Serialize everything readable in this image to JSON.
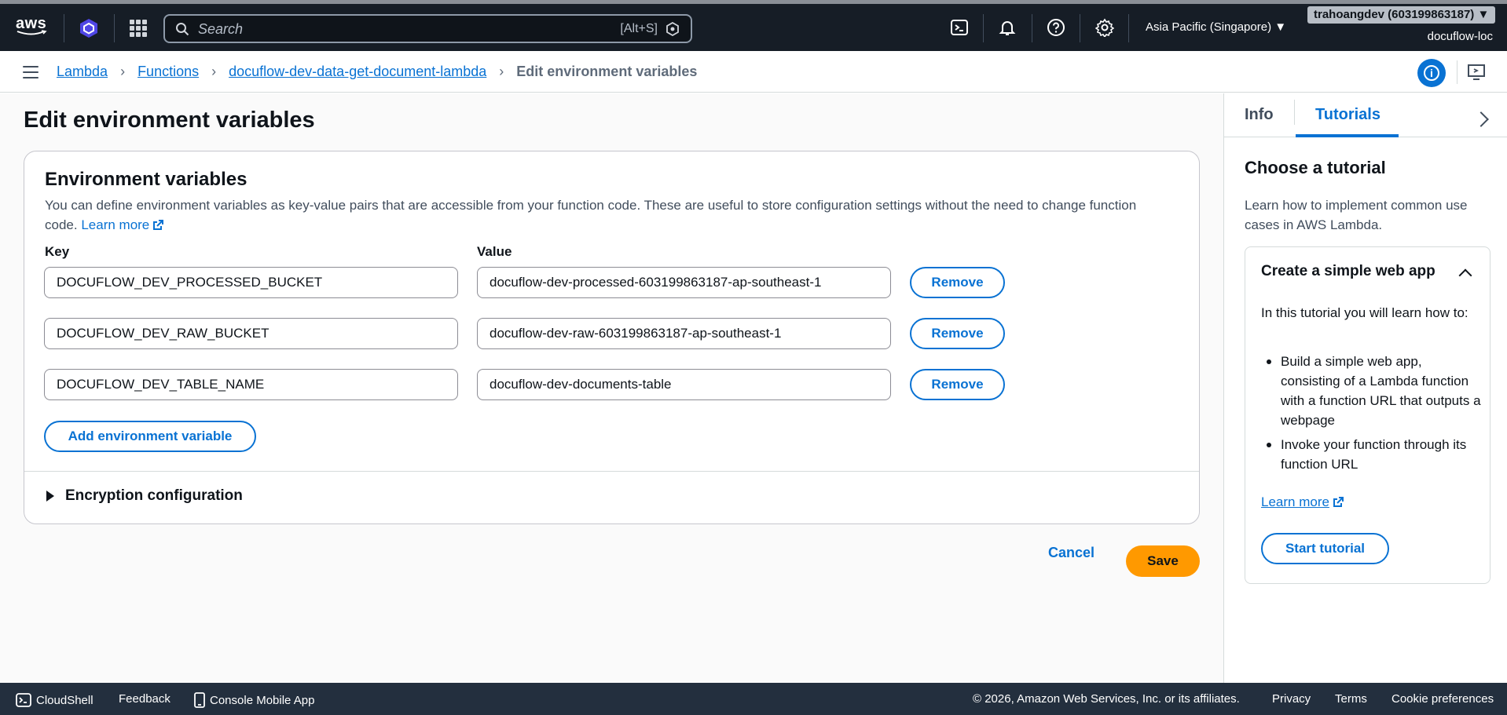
{
  "topnav": {
    "logo_text": "aws",
    "search_placeholder": "Search",
    "search_shortcut": "[Alt+S]",
    "region": "Asia Pacific (Singapore) ▼",
    "account": "trahoangdev (603199863187) ▼",
    "account_sub": "docuflow-loc"
  },
  "breadcrumb": {
    "items": [
      "Lambda",
      "Functions",
      "docuflow-dev-data-get-document-lambda"
    ],
    "current": "Edit environment variables"
  },
  "page": {
    "title": "Edit environment variables"
  },
  "env_card": {
    "title": "Environment variables",
    "description": "You can define environment variables as key-value pairs that are accessible from your function code. These are useful to store configuration settings without the need to change function code.",
    "learn_more": "Learn more",
    "key_label": "Key",
    "value_label": "Value",
    "rows": [
      {
        "key": "DOCUFLOW_DEV_PROCESSED_BUCKET",
        "value": "docuflow-dev-processed-603199863187-ap-southeast-1",
        "remove": "Remove"
      },
      {
        "key": "DOCUFLOW_DEV_RAW_BUCKET",
        "value": "docuflow-dev-raw-603199863187-ap-southeast-1",
        "remove": "Remove"
      },
      {
        "key": "DOCUFLOW_DEV_TABLE_NAME",
        "value": "docuflow-dev-documents-table",
        "remove": "Remove"
      }
    ],
    "add_button": "Add environment variable",
    "encryption": "Encryption configuration"
  },
  "actions": {
    "cancel": "Cancel",
    "save": "Save"
  },
  "panel": {
    "tabs": [
      "Info",
      "Tutorials"
    ],
    "active_tab": "Tutorials",
    "title": "Choose a tutorial",
    "description": "Learn how to implement common use cases in AWS Lambda.",
    "tutorial": {
      "title": "Create a simple web app",
      "intro": "In this tutorial you will learn how to:",
      "bullets": [
        "Build a simple web app, consisting of a Lambda function with a function URL that outputs a webpage",
        "Invoke your function through its function URL"
      ],
      "learn_more": "Learn more",
      "start": "Start tutorial"
    }
  },
  "footer": {
    "cloudshell": "CloudShell",
    "feedback": "Feedback",
    "mobile_app": "Console Mobile App",
    "copyright": "© 2026, Amazon Web Services, Inc. or its affiliates.",
    "privacy": "Privacy",
    "terms": "Terms",
    "cookies": "Cookie preferences"
  },
  "colors": {
    "nav_bg": "#161d26",
    "accent_blue": "#0972d3",
    "save_orange": "#ff9900",
    "footer_bg": "#232f3e"
  }
}
